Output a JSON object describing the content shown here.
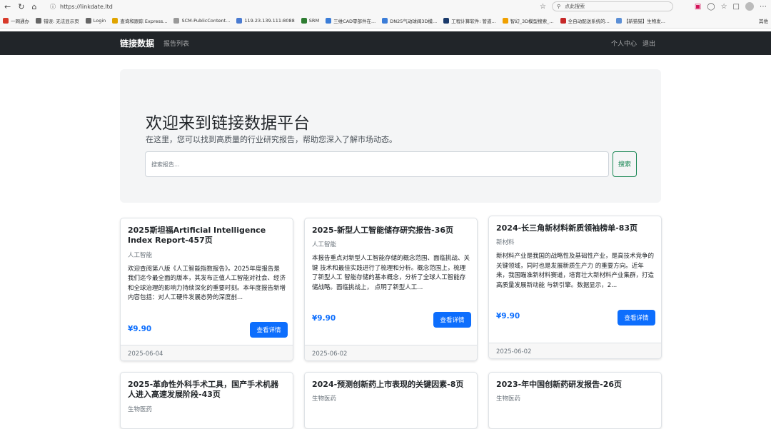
{
  "browser": {
    "url": "https://linkdate.ltd",
    "search_placeholder": "点此搜索",
    "bookmarks": [
      {
        "label": "一网通办",
        "color": "#d83a2a"
      },
      {
        "label": "错误: 无法显示页",
        "color": "#666666"
      },
      {
        "label": "Login",
        "color": "#666666"
      },
      {
        "label": "查询和跟踪 Express...",
        "color": "#e0a400"
      },
      {
        "label": "SCM-PublicContent...",
        "color": "#999999"
      },
      {
        "label": "119.23.139.111:8088",
        "color": "#4a7bd1"
      },
      {
        "label": "SRM",
        "color": "#2e7d32"
      },
      {
        "label": "三维CAD零部件在...",
        "color": "#3b7dd8"
      },
      {
        "label": "DN25气动球阀3D模...",
        "color": "#3b7dd8"
      },
      {
        "label": "工程计算软件: 管道...",
        "color": "#1a3a6b"
      },
      {
        "label": "智幻_3D模型搜索_...",
        "color": "#f0a000"
      },
      {
        "label": "全自动配送系统的...",
        "color": "#c62828"
      },
      {
        "label": "【新猫猫】生物发...",
        "color": "#5b8fd6"
      }
    ],
    "other_bookmarks": "其他"
  },
  "navbar": {
    "brand": "链接数据",
    "report_list": "报告列表",
    "personal_center": "个人中心",
    "logout": "退出"
  },
  "hero": {
    "title": "欢迎来到链接数据平台",
    "subtitle": "在这里，您可以找到高质量的行业研究报告，帮助您深入了解市场动态。",
    "search_placeholder": "搜索报告...",
    "search_button": "搜索"
  },
  "cards": [
    {
      "title": "2025斯坦福Artificial Intelligence Index Report-457页",
      "category": "人工智能",
      "description": "欢迎查阅第八版《人工智能指数报告》。2025年度报告是我们迄今最全面的版本，其发布正值人工智能对社会、经济和全球治理的影响力持续深化的重要时刻。本年度报告新增内容包括：对人工硬件发展态势的深度剖...",
      "price": "¥9.90",
      "button": "查看详情",
      "date": "2025-06-04"
    },
    {
      "title": "2025-新型人工智能储存研究报告-36页",
      "category": "人工智能",
      "description": "本报告重点对新型人工智能存储的概念范围、面临挑战、关键 技术和最佳实践进行了梳理和分析。概念范围上，梳理了新型人工 智能存储的基本概念，分析了全球人工智能存储战略。面临挑战上， 点明了新型人工...",
      "price": "¥9.90",
      "button": "查看详情",
      "date": "2025-06-02"
    },
    {
      "title": "2024-长三角新材料新质领袖榜单-83页",
      "category": "新材料",
      "description": "新材料产业是我国的战略性及基础性产业，是高技术竞争的关键领域，同时也是发展新质生产力 的重要方向。近年来，我国瞄准新材料赛道，培育壮大新材料产业集群，打造高质量发展新动能 与新引擎。数据显示，2...",
      "price": "¥9.90",
      "button": "查看详情",
      "date": "2025-06-02"
    },
    {
      "title": "2025-革命性外科手术工具，国产手术机器人进入高速发展阶段-43页",
      "category": "生物医药"
    },
    {
      "title": "2024-预测创新药上市表现的关键因素-8页",
      "category": "生物医药"
    },
    {
      "title": "2023-年中国创新药研发报告-26页",
      "category": "生物医药"
    }
  ]
}
